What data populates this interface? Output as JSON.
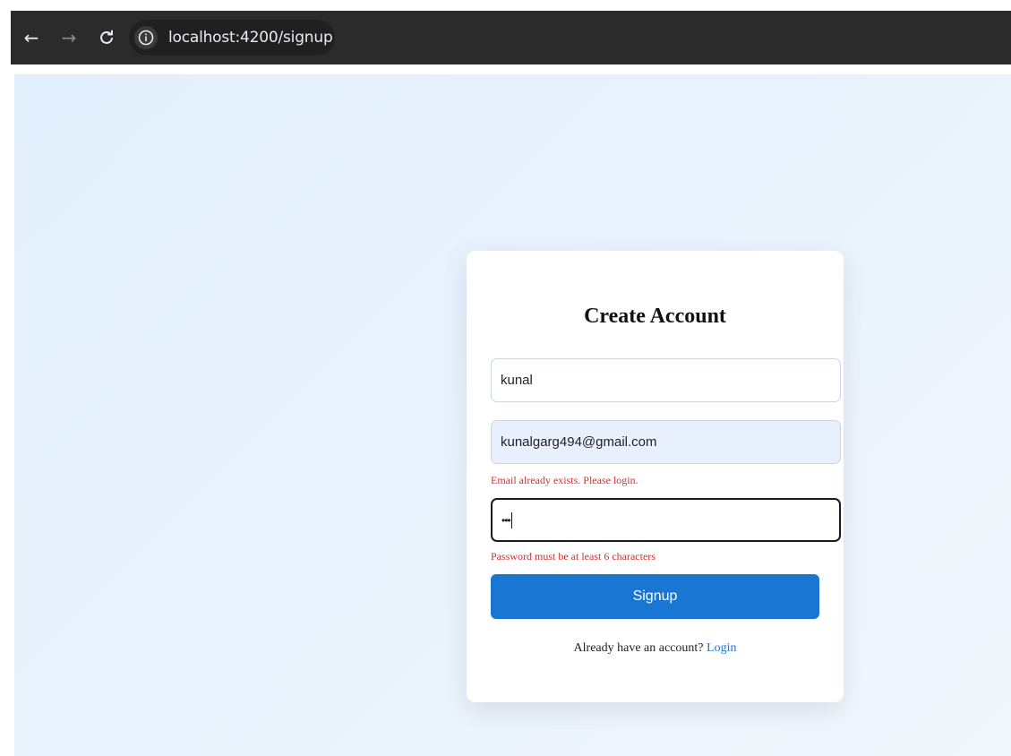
{
  "browser": {
    "url": "localhost:4200/signup",
    "back_icon": "←",
    "forward_icon": "→",
    "reload_icon": "C"
  },
  "form": {
    "title": "Create Account",
    "name_value": "kunal",
    "email_value": "kunalgarg494@gmail.com",
    "password_masked": "•••",
    "email_error": "Email already exists. Please login.",
    "password_error": "Password must be at least 6 characters",
    "submit_label": "Signup",
    "login_prompt": "Already have an account?",
    "login_link": "Login"
  },
  "colors": {
    "primary": "#1976d2",
    "error": "#d32f2f",
    "autofill_bg": "#e8f0fd"
  }
}
